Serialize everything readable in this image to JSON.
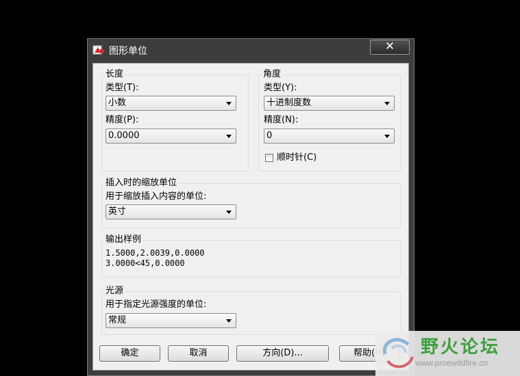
{
  "window": {
    "title": "图形单位",
    "close_glyph": "✕"
  },
  "length": {
    "group_title": "长度",
    "type_label": "类型(T):",
    "type_value": "小数",
    "precision_label": "精度(P):",
    "precision_value": "0.0000"
  },
  "angle": {
    "group_title": "角度",
    "type_label": "类型(Y):",
    "type_value": "十进制度数",
    "precision_label": "精度(N):",
    "precision_value": "0",
    "clockwise_label": "顺时针(C)",
    "clockwise_checked": false
  },
  "insert_scale": {
    "group_title": "插入时的缩放单位",
    "label": "用于缩放插入内容的单位:",
    "value": "英寸"
  },
  "sample_output": {
    "group_title": "输出样例",
    "line1": "1.5000,2.0039,0.0000",
    "line2": "3.0000<45,0.0000"
  },
  "lighting": {
    "group_title": "光源",
    "label": "用于指定光源强度的单位:",
    "value": "常规"
  },
  "buttons": {
    "ok": "确定",
    "cancel": "取消",
    "direction": "方向(D)...",
    "help": "帮助(H)"
  },
  "watermark": {
    "title": "野火论坛",
    "url": "www.proewildfire.cn"
  },
  "icons": [
    "app-icon",
    "close-icon",
    "chevron-down-icon",
    "checkbox-icon",
    "watermark-logo-icon"
  ]
}
